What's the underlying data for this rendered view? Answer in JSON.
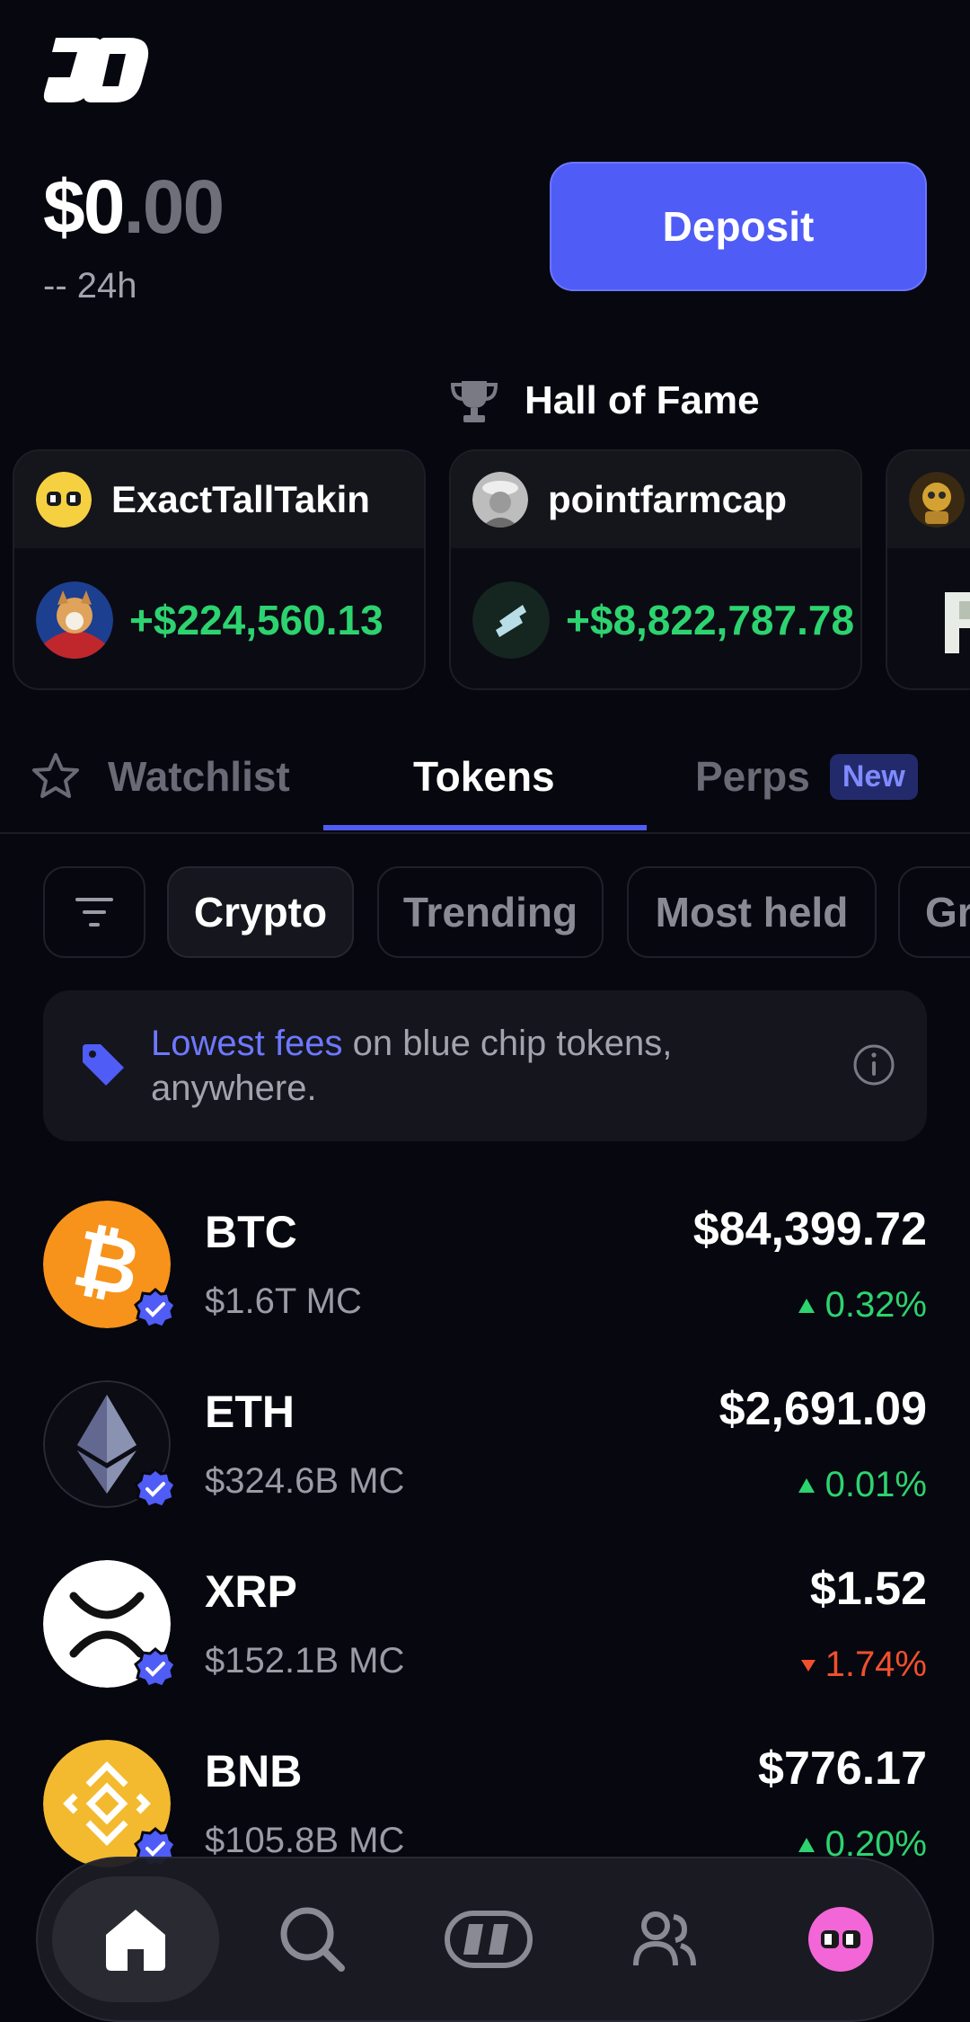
{
  "header": {
    "balance_main": "$0",
    "balance_cents": ".00",
    "change_24h": "-- 24h",
    "deposit_label": "Deposit"
  },
  "hall_of_fame": {
    "title": "Hall of Fame",
    "cards": [
      {
        "name": "ExactTallTakin",
        "profit": "+$224,560.13"
      },
      {
        "name": "pointfarmcap",
        "profit": "+$8,822,787.78"
      }
    ]
  },
  "tabs": [
    {
      "label": "Watchlist"
    },
    {
      "label": "Tokens"
    },
    {
      "label": "Perps",
      "badge": "New"
    }
  ],
  "filters": [
    "Crypto",
    "Trending",
    "Most held",
    "Gr"
  ],
  "banner": {
    "highlight": "Lowest fees",
    "text": " on blue chip tokens, anywhere."
  },
  "tokens": [
    {
      "symbol": "BTC",
      "market_cap": "$1.6T MC",
      "price": "$84,399.72",
      "change": "0.32%",
      "direction": "up"
    },
    {
      "symbol": "ETH",
      "market_cap": "$324.6B MC",
      "price": "$2,691.09",
      "change": "0.01%",
      "direction": "up"
    },
    {
      "symbol": "XRP",
      "market_cap": "$152.1B MC",
      "price": "$1.52",
      "change": "1.74%",
      "direction": "down"
    },
    {
      "symbol": "BNB",
      "market_cap": "$105.8B MC",
      "price": "$776.17",
      "change": "0.20%",
      "direction": "up"
    }
  ],
  "nav": [
    "home-icon",
    "search-icon",
    "app-logo-icon",
    "friends-icon",
    "profile-icon"
  ],
  "colors": {
    "accent": "#4f5cf6",
    "positive": "#2dd36f",
    "negative": "#f0502d",
    "background": "#07070f"
  }
}
